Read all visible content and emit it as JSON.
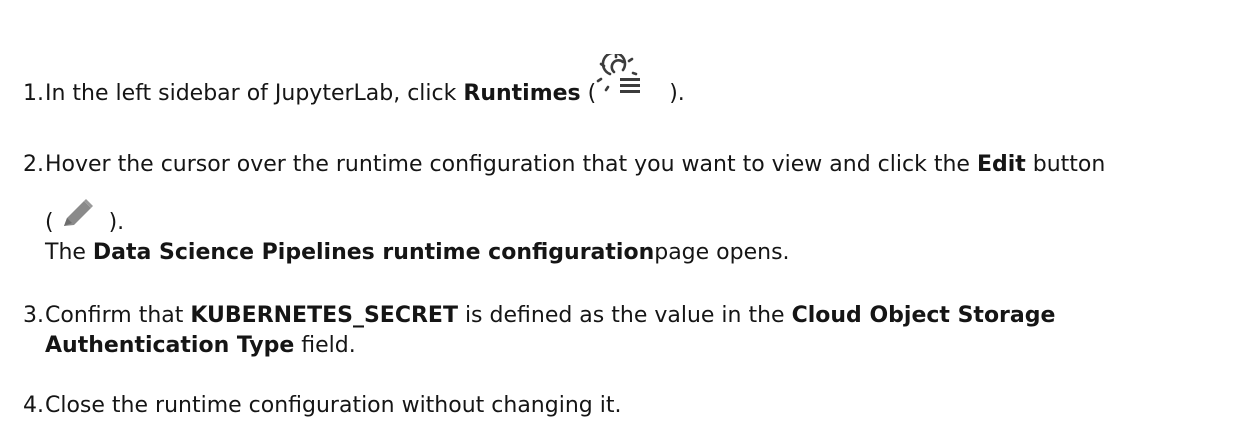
{
  "steps": [
    {
      "number": "1.",
      "text_before": "In the left sidebar of JupyterLab, click ",
      "bold": "Runtimes",
      "text_after_open": " (",
      "icon": "runtimes-icon",
      "text_after_close": " )."
    },
    {
      "number": "2.",
      "text_before": "Hover the cursor over the runtime configuration that you want to view and click the ",
      "bold": "Edit",
      "text_after": " button",
      "line2_open": "(",
      "icon": "pencil-icon",
      "line2_close": " ).",
      "line3_bold": "Data Science Pipelines runtime configuration",
      "line3_after": "page opens.",
      "line3_before": "The "
    },
    {
      "number": "3.",
      "text_before": "Confirm that ",
      "bold": "KUBERNETES_SECRET",
      "text_mid": " is defined as the value in the ",
      "bold2": "Cloud Object Storage",
      "line2_bold": "Authentication Type",
      "line2_after": " field."
    },
    {
      "number": "4.",
      "text": "Close the runtime configuration without changing it."
    }
  ]
}
